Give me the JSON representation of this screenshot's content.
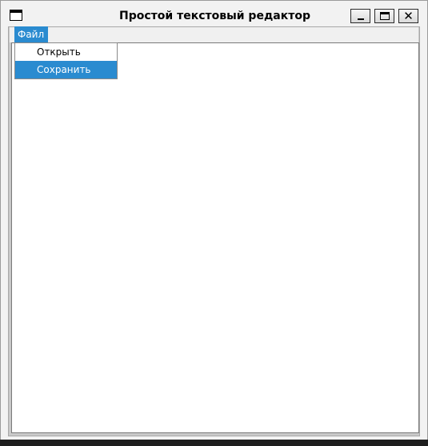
{
  "window": {
    "title": "Простой текстовый редактор"
  },
  "titlebar_buttons": {
    "minimize_icon": "minimize-icon",
    "maximize_icon": "maximize-icon",
    "close_icon": "close-icon",
    "close_glyph": "✕"
  },
  "menubar": {
    "file_label": "Файл"
  },
  "file_menu": {
    "items": [
      {
        "label": "Открыть",
        "highlighted": false
      },
      {
        "label": "Сохранить",
        "highlighted": true
      }
    ]
  },
  "colors": {
    "accent": "#2a8bd0",
    "window_bg": "#f2f2f2",
    "editor_bg": "#ffffff"
  }
}
